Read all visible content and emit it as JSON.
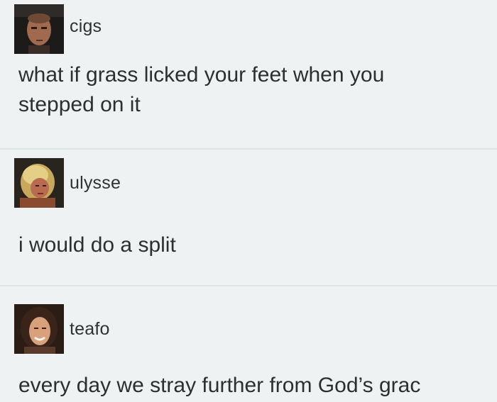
{
  "posts": [
    {
      "username": "cigs",
      "avatar_icon": "man-headshot-avatar",
      "lines": [
        "what if grass licked your feet when you",
        "stepped on it"
      ]
    },
    {
      "username": "ulysse",
      "avatar_icon": "blonde-person-avatar",
      "lines": [
        "i would do a split"
      ]
    },
    {
      "username": "teafo",
      "avatar_icon": "smiling-woman-avatar",
      "lines": [
        "every day we stray further from God’s grac"
      ]
    }
  ],
  "colors": {
    "background": "#eef2f2",
    "text": "#2c2f30",
    "divider": "#dde3e4"
  }
}
